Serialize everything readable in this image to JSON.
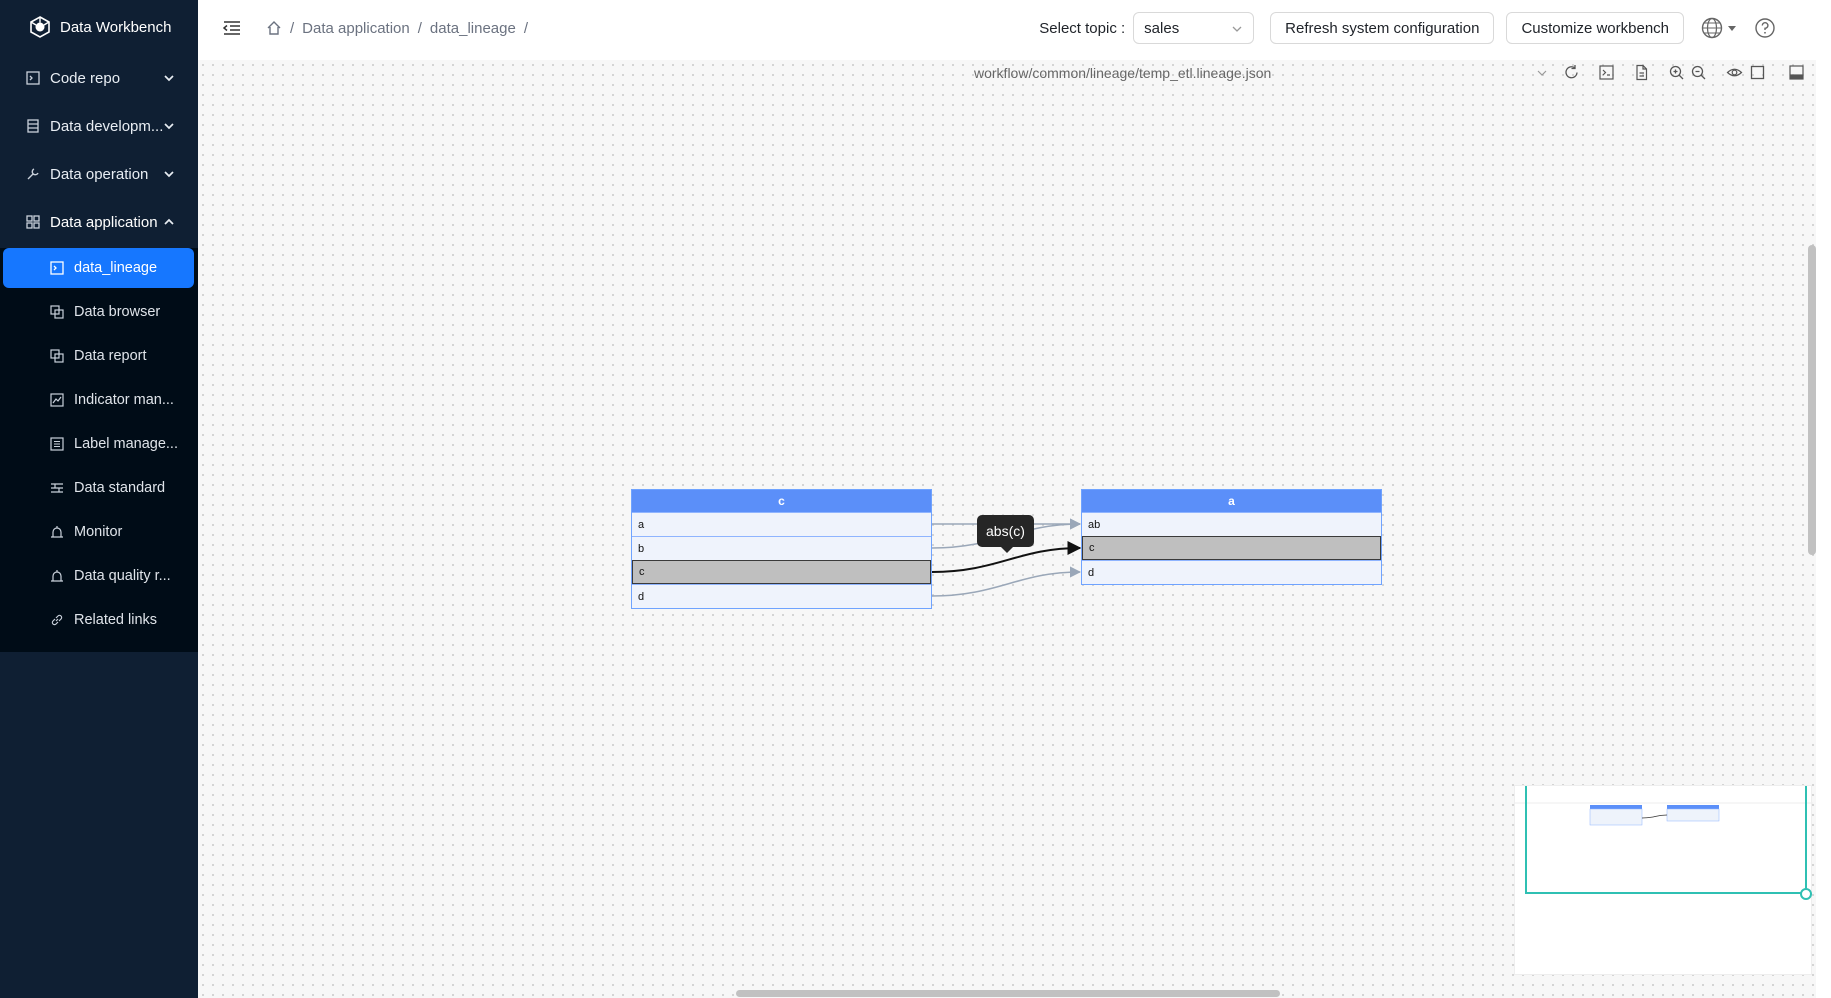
{
  "app": {
    "title": "Data Workbench"
  },
  "sidebar": {
    "items": [
      {
        "label": "Code repo",
        "icon": "code-icon"
      },
      {
        "label": "Data developm...",
        "icon": "database-icon"
      },
      {
        "label": "Data operation",
        "icon": "wrench-icon"
      },
      {
        "label": "Data application",
        "icon": "grid-icon"
      }
    ],
    "subitems": [
      {
        "label": "data_lineage",
        "icon": "lineage-icon",
        "active": true
      },
      {
        "label": "Data browser",
        "icon": "copy-icon"
      },
      {
        "label": "Data report",
        "icon": "copy-icon"
      },
      {
        "label": "Indicator man...",
        "icon": "chart-icon"
      },
      {
        "label": "Label manage...",
        "icon": "list-icon"
      },
      {
        "label": "Data standard",
        "icon": "standard-icon"
      },
      {
        "label": "Monitor",
        "icon": "alarm-icon"
      },
      {
        "label": "Data quality r...",
        "icon": "alarm-icon"
      },
      {
        "label": "Related links",
        "icon": "link-icon"
      }
    ]
  },
  "header": {
    "breadcrumb": [
      "Data application",
      "data_lineage"
    ],
    "topic_label": "Select topic :",
    "topic_value": "sales",
    "refresh_label": "Refresh system configuration",
    "customize_label": "Customize workbench"
  },
  "canvas": {
    "file_path": "workflow/common/lineage/temp_etl.lineage.json",
    "source_table": {
      "name": "c",
      "columns": [
        "a",
        "b",
        "c",
        "d"
      ],
      "highlighted": "c"
    },
    "target_table": {
      "name": "a",
      "columns": [
        "ab",
        "c",
        "d"
      ],
      "highlighted": "c"
    },
    "tooltip": "abs(c)",
    "colors": {
      "header": "#5b8ff9",
      "edge": "#9aa7b8",
      "edge_active": "#111111",
      "minimap": "#2fc0b3"
    }
  }
}
